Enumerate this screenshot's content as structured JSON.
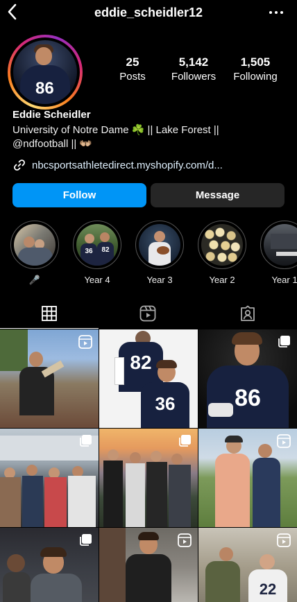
{
  "header": {
    "username": "eddie_scheidler12",
    "back_icon": "chevron-left-icon",
    "more_icon": "more-horizontal-icon"
  },
  "profile": {
    "name": "Eddie Scheidler",
    "bio_line1": "University of Notre Dame ☘️ || Lake Forest ||",
    "bio_line2": "@ndfootball || 👐🏼",
    "link": "nbcsportsathletedirect.myshopify.com/d...",
    "avatar_jersey_number": "86"
  },
  "stats": {
    "posts": {
      "value": "25",
      "label": "Posts"
    },
    "followers": {
      "value": "5,142",
      "label": "Followers"
    },
    "following": {
      "value": "1,505",
      "label": "Following"
    }
  },
  "actions": {
    "follow_label": "Follow",
    "message_label": "Message",
    "follow_color": "#0095f6",
    "message_color": "#262626"
  },
  "highlights": [
    {
      "label": "🎤"
    },
    {
      "label": "Year 4"
    },
    {
      "label": "Year 3"
    },
    {
      "label": "Year 2"
    },
    {
      "label": "Year 1"
    }
  ],
  "tabs": [
    {
      "name": "posts-grid",
      "icon": "grid-icon",
      "active": true
    },
    {
      "name": "reels",
      "icon": "reels-icon",
      "active": false
    },
    {
      "name": "tagged",
      "icon": "tagged-person-icon",
      "active": false
    }
  ],
  "grid_posts": [
    {
      "badge": "reel-icon"
    },
    {
      "badge": ""
    },
    {
      "badge": "carousel-icon"
    },
    {
      "badge": "carousel-icon"
    },
    {
      "badge": "carousel-icon"
    },
    {
      "badge": "reel-icon"
    },
    {
      "badge": "carousel-icon"
    },
    {
      "badge": "reel-icon"
    },
    {
      "badge": "reel-icon"
    }
  ]
}
